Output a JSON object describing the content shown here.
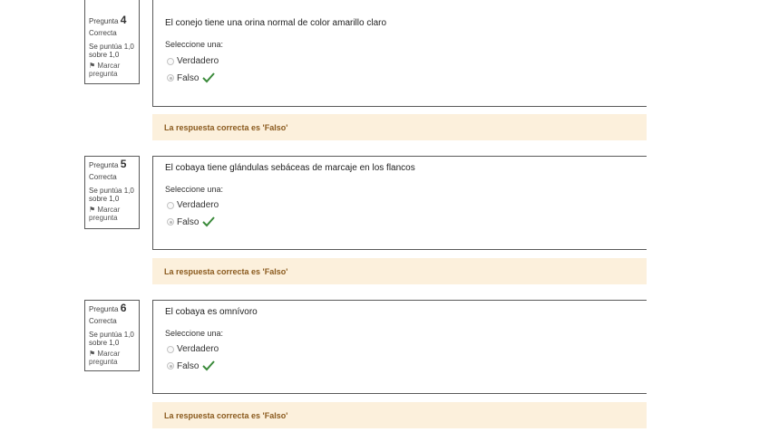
{
  "questions": [
    {
      "number_label": "Pregunta",
      "number": "4",
      "state": "Correcta",
      "grade": "Se puntúa 1,0 sobre 1,0",
      "flag": "Marcar pregunta",
      "text": "El conejo tiene una orina normal de color amarillo claro",
      "prompt": "Seleccione una:",
      "options": [
        "Verdadero",
        "Falso"
      ],
      "selected": "Falso",
      "feedback": "La respuesta correcta es 'Falso'"
    },
    {
      "number_label": "Pregunta",
      "number": "5",
      "state": "Correcta",
      "grade": "Se puntúa 1,0 sobre 1,0",
      "flag": "Marcar pregunta",
      "text": "El cobaya tiene glándulas sebáceas de marcaje en los flancos",
      "prompt": "Seleccione una:",
      "options": [
        "Verdadero",
        "Falso"
      ],
      "selected": "Falso",
      "feedback": "La respuesta correcta es 'Falso'"
    },
    {
      "number_label": "Pregunta",
      "number": "6",
      "state": "Correcta",
      "grade": "Se puntúa 1,0 sobre 1,0",
      "flag": "Marcar pregunta",
      "text": "El cobaya es omnívoro",
      "prompt": "Seleccione una:",
      "options": [
        "Verdadero",
        "Falso"
      ],
      "selected": "Falso",
      "feedback": "La respuesta correcta es 'Falso'"
    }
  ],
  "colors": {
    "feedback_bg": "#fcf0dc",
    "feedback_text": "#8a5a1e",
    "check": "#3a8a3a",
    "border": "#5a5a5a"
  },
  "icons": {
    "correct": "check-icon",
    "flag": "flag-icon"
  }
}
